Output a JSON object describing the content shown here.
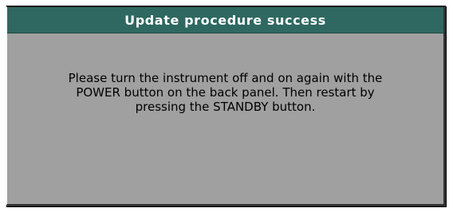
{
  "dialog": {
    "title": "Update procedure success",
    "message_lines": [
      "Please turn the instrument off and on again with the",
      "POWER button on the back panel. Then restart by",
      "pressing the STANDBY button."
    ]
  },
  "colors": {
    "title_bar": "#2e6860",
    "dialog_background": "#a0a0a0",
    "title_text": "#ffffff",
    "message_text": "#000000"
  }
}
